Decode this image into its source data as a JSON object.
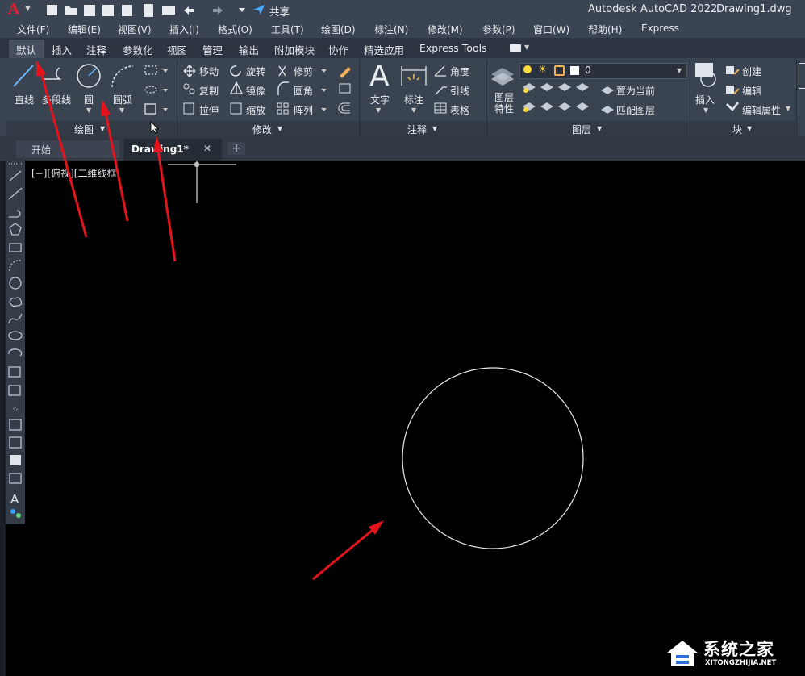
{
  "app": {
    "logo_letter": "A",
    "quick_access_share": "共享",
    "title": "Autodesk AutoCAD 2022",
    "file_name": "Drawing1.dwg"
  },
  "menus": [
    "文件(F)",
    "编辑(E)",
    "视图(V)",
    "插入(I)",
    "格式(O)",
    "工具(T)",
    "绘图(D)",
    "标注(N)",
    "修改(M)",
    "参数(P)",
    "窗口(W)",
    "帮助(H)",
    "Express"
  ],
  "ribbon_tabs": [
    "默认",
    "插入",
    "注释",
    "参数化",
    "视图",
    "管理",
    "输出",
    "附加模块",
    "协作",
    "精选应用",
    "Express Tools"
  ],
  "ribbon": {
    "draw": {
      "title": "绘图",
      "line": "直线",
      "polyline": "多段线",
      "circle": "圆",
      "arc": "圆弧"
    },
    "modify": {
      "title": "修改",
      "move": "移动",
      "rotate": "旋转",
      "trim": "修剪",
      "copy": "复制",
      "mirror": "镜像",
      "fillet": "圆角",
      "stretch": "拉伸",
      "scale": "缩放",
      "array": "阵列"
    },
    "annotation": {
      "title": "注释",
      "text": "文字",
      "dimension": "标注",
      "angular": "角度",
      "leader": "引线",
      "table": "表格"
    },
    "layers": {
      "title": "图层",
      "layer_properties": "图层\n特性",
      "layer_name": "0",
      "set_current": "置为当前",
      "match_layer": "匹配图层"
    },
    "block": {
      "title": "块",
      "insert": "插入",
      "create": "创建",
      "edit": "编辑",
      "edit_attributes": "编辑属性"
    }
  },
  "doc_tabs": {
    "start": "开始",
    "active": "Drawing1*",
    "close": "✕",
    "add": "+"
  },
  "viewport": {
    "label": "[−][俯视][二维线框"
  },
  "watermark": {
    "site_name": "系统之家",
    "site_url": "XITONGZHIJIA.NET"
  },
  "colors": {
    "accent_red": "#e3141b",
    "title_bg": "#3b4453",
    "ribbon_bg": "#3a4350"
  }
}
